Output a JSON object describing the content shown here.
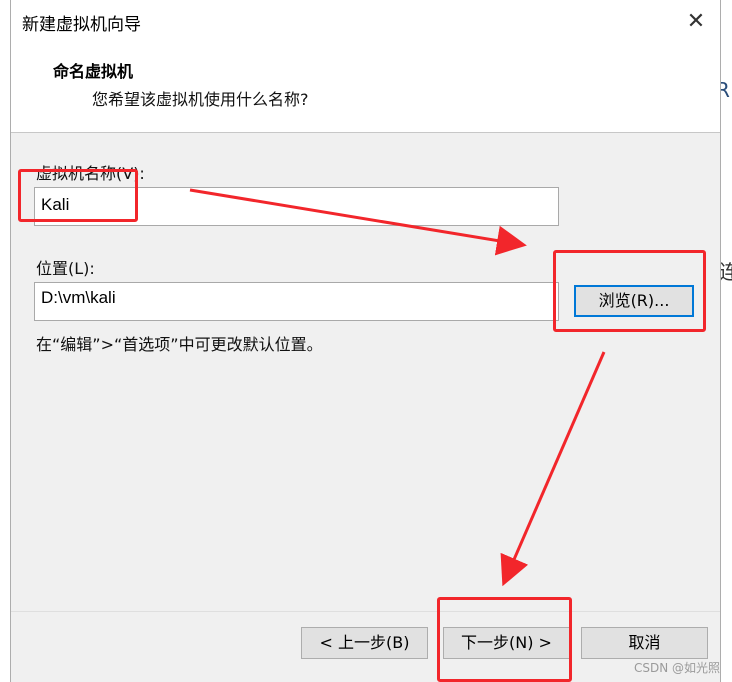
{
  "window": {
    "title": "新建虚拟机向导",
    "close_glyph": "✕"
  },
  "header": {
    "title": "命名虚拟机",
    "subtitle": "您希望该虚拟机使用什么名称?"
  },
  "form": {
    "name_label": "虚拟机名称(V):",
    "name_value": "Kali",
    "location_label": "位置(L):",
    "location_value": "D:\\vm\\kali",
    "browse_button": "浏览(R)...",
    "hint": "在“编辑”>“首选项”中可更改默认位置。"
  },
  "footer": {
    "back_button": "< 上一步(B)",
    "next_button": "下一步(N) >",
    "cancel_button": "取消"
  },
  "background_fragments": {
    "right_top": "R",
    "right_mid": "连"
  },
  "watermark": "CSDN @如光照",
  "colors": {
    "annotation_red": "#f2262b",
    "focus_blue": "#0078d7"
  }
}
